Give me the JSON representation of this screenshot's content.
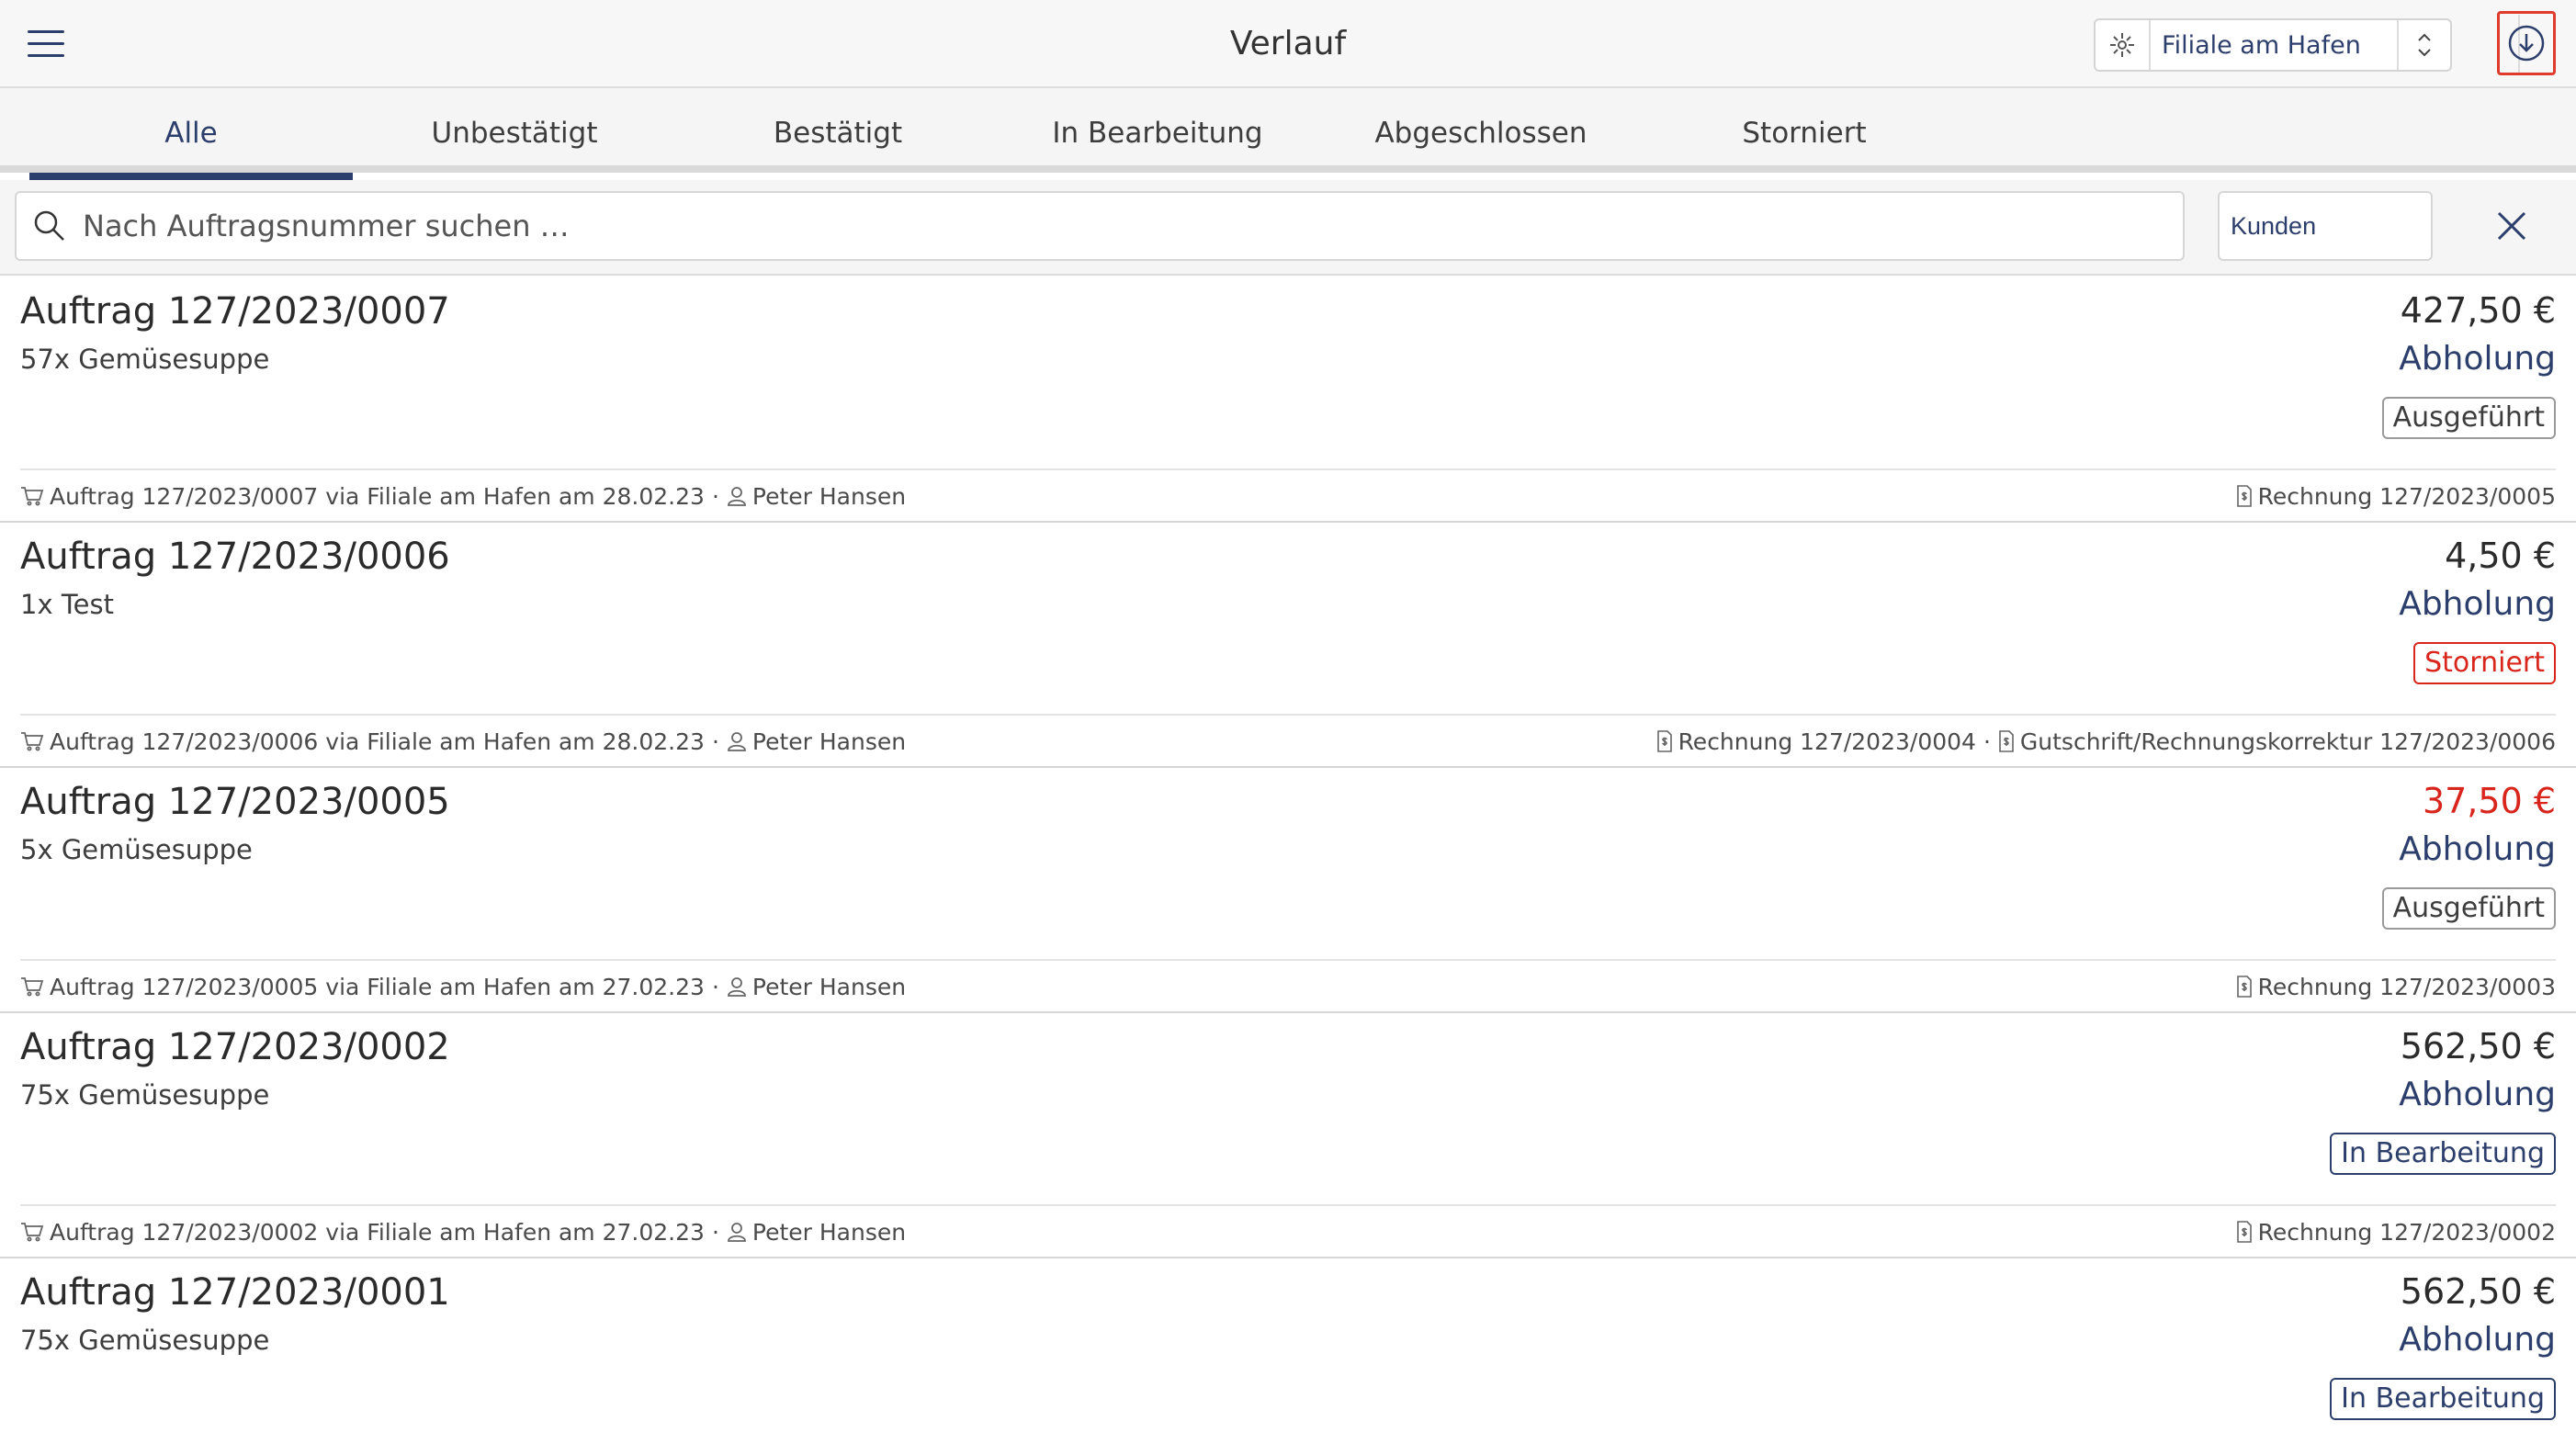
{
  "header": {
    "menu_icon": "hamburger-icon",
    "title": "Verlauf",
    "branch": {
      "icon": "store-icon",
      "label": "Filiale am Hafen"
    },
    "download_icon": "download-icon"
  },
  "tabs": [
    {
      "label": "Alle",
      "active": true
    },
    {
      "label": "Unbestätigt",
      "active": false
    },
    {
      "label": "Bestätigt",
      "active": false
    },
    {
      "label": "In Bearbeitung",
      "active": false
    },
    {
      "label": "Abgeschlossen",
      "active": false
    },
    {
      "label": "Storniert",
      "active": false
    }
  ],
  "search": {
    "placeholder": "Nach Auftragsnummer suchen …",
    "value": "",
    "filter_label": "Kunden"
  },
  "orders": [
    {
      "title": "Auftrag 127/2023/0007",
      "items": "57x Gemüsesuppe",
      "price": "427,50 €",
      "delivery": "Abholung",
      "status": "Ausgeführt",
      "meta_order": "Auftrag 127/2023/0007 via Filiale am Hafen am 28.02.23",
      "meta_user": "Peter Hansen",
      "invoice": "Rechnung 127/2023/0005",
      "credit_note": ""
    },
    {
      "title": "Auftrag 127/2023/0006",
      "items": "1x Test",
      "price": "4,50 €",
      "delivery": "Abholung",
      "status": "Storniert",
      "meta_order": "Auftrag 127/2023/0006 via Filiale am Hafen am 28.02.23",
      "meta_user": "Peter Hansen",
      "invoice": "Rechnung 127/2023/0004",
      "credit_note": "Gutschrift/Rechnungskorrektur 127/2023/0006"
    },
    {
      "title": "Auftrag 127/2023/0005",
      "items": "5x Gemüsesuppe",
      "price": "37,50 €",
      "delivery": "Abholung",
      "status": "Ausgeführt",
      "meta_order": "Auftrag 127/2023/0005 via Filiale am Hafen am 27.02.23",
      "meta_user": "Peter Hansen",
      "invoice": "Rechnung 127/2023/0003",
      "credit_note": ""
    },
    {
      "title": "Auftrag 127/2023/0002",
      "items": "75x Gemüsesuppe",
      "price": "562,50 €",
      "delivery": "Abholung",
      "status": "In Bearbeitung",
      "meta_order": "Auftrag 127/2023/0002 via Filiale am Hafen am 27.02.23",
      "meta_user": "Peter Hansen",
      "invoice": "Rechnung 127/2023/0002",
      "credit_note": ""
    },
    {
      "title": "Auftrag 127/2023/0001",
      "items": "75x Gemüsesuppe",
      "price": "562,50 €",
      "delivery": "Abholung",
      "status": "In Bearbeitung",
      "meta_order": "",
      "meta_user": "",
      "invoice": "",
      "credit_note": ""
    }
  ],
  "colors": {
    "accent": "#2c3e6b",
    "danger": "#d9261c",
    "highlight": "#e03c2e"
  }
}
